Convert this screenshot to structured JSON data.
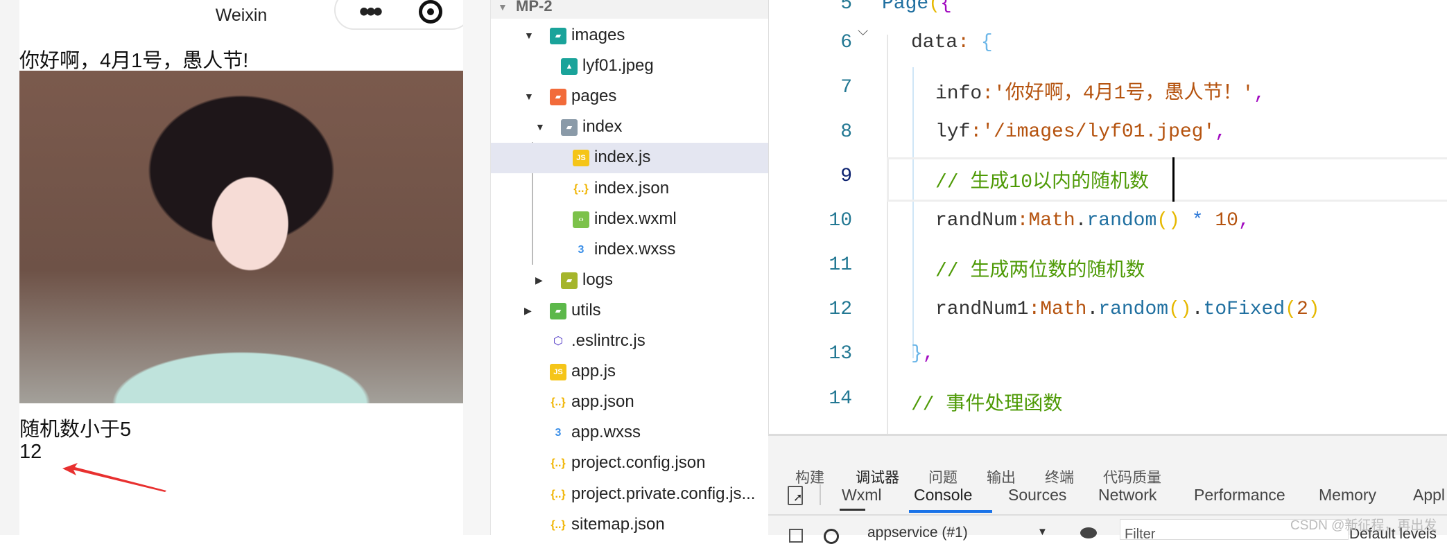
{
  "simulator": {
    "nav_title": "Weixin",
    "info": "你好啊，4月1号，愚人节!",
    "image_alt": "lyf01.jpeg",
    "line1": "随机数小于5",
    "line2": "12",
    "arrow_color": "#e8302f"
  },
  "file_tree": {
    "project": "MP-2",
    "items": [
      {
        "label": "images",
        "icon": "folder-images-icon",
        "depth": 1,
        "expanded": true
      },
      {
        "label": "lyf01.jpeg",
        "icon": "image-file-icon",
        "depth": 2
      },
      {
        "label": "pages",
        "icon": "folder-pages-icon",
        "depth": 1,
        "expanded": true
      },
      {
        "label": "index",
        "icon": "folder-icon",
        "depth": 2,
        "expanded": true
      },
      {
        "label": "index.js",
        "icon": "js-file-icon",
        "depth": 3,
        "selected": true
      },
      {
        "label": "index.json",
        "icon": "json-file-icon",
        "depth": 3
      },
      {
        "label": "index.wxml",
        "icon": "wxml-file-icon",
        "depth": 3
      },
      {
        "label": "index.wxss",
        "icon": "css-file-icon",
        "depth": 3
      },
      {
        "label": "logs",
        "icon": "folder-logs-icon",
        "depth": 2,
        "expanded": false
      },
      {
        "label": "utils",
        "icon": "folder-utils-icon",
        "depth": 1,
        "expanded": false
      },
      {
        "label": ".eslintrc.js",
        "icon": "eslint-icon",
        "depth": 1
      },
      {
        "label": "app.js",
        "icon": "js-file-icon",
        "depth": 1
      },
      {
        "label": "app.json",
        "icon": "json-file-icon",
        "depth": 1
      },
      {
        "label": "app.wxss",
        "icon": "css-file-icon",
        "depth": 1
      },
      {
        "label": "project.config.json",
        "icon": "json-file-icon",
        "depth": 1
      },
      {
        "label": "project.private.config.js...",
        "icon": "json-file-icon",
        "depth": 1
      },
      {
        "label": "sitemap.json",
        "icon": "json-file-icon",
        "depth": 1
      }
    ]
  },
  "editor": {
    "line_numbers": [
      "5",
      "6",
      "7",
      "8",
      "9",
      "10",
      "11",
      "12",
      "13",
      "14"
    ],
    "lines": {
      "l5": [
        "Page",
        "(",
        "{"
      ],
      "l6": [
        "data",
        ":",
        " ",
        "{"
      ],
      "l7": [
        "info",
        ":",
        "'你好啊，4月1号，愚人节！'",
        ","
      ],
      "l8": [
        "lyf",
        ":",
        "'/images/lyf01.jpeg'",
        ","
      ],
      "l9": [
        "// 生成10以内的随机数"
      ],
      "l10": [
        "randNum",
        ":",
        "Math",
        ".",
        "random",
        "()",
        " * ",
        "10",
        ","
      ],
      "l11": [
        "// 生成两位数的随机数"
      ],
      "l12": [
        "randNum1",
        ":",
        "Math",
        ".",
        "random",
        "()",
        ".",
        "toFixed",
        "(",
        "2",
        ")"
      ],
      "l13": [
        "}",
        ","
      ],
      "l14": [
        "// 事件处理函数"
      ]
    },
    "current_line": "9"
  },
  "panel": {
    "tabs": [
      "构建",
      "调试器",
      "问题",
      "输出",
      "终端",
      "代码质量"
    ],
    "active_tab": "调试器",
    "devtools_tabs": [
      "Wxml",
      "Console",
      "Sources",
      "Network",
      "Performance",
      "Memory",
      "Appl"
    ],
    "active_devtools_tab": "Console",
    "context": "appservice (#1)",
    "filter_placeholder": "Filter",
    "levels": "Default levels",
    "accent": "#1a73e8"
  },
  "watermark": "CSDN @新征程，再出发"
}
